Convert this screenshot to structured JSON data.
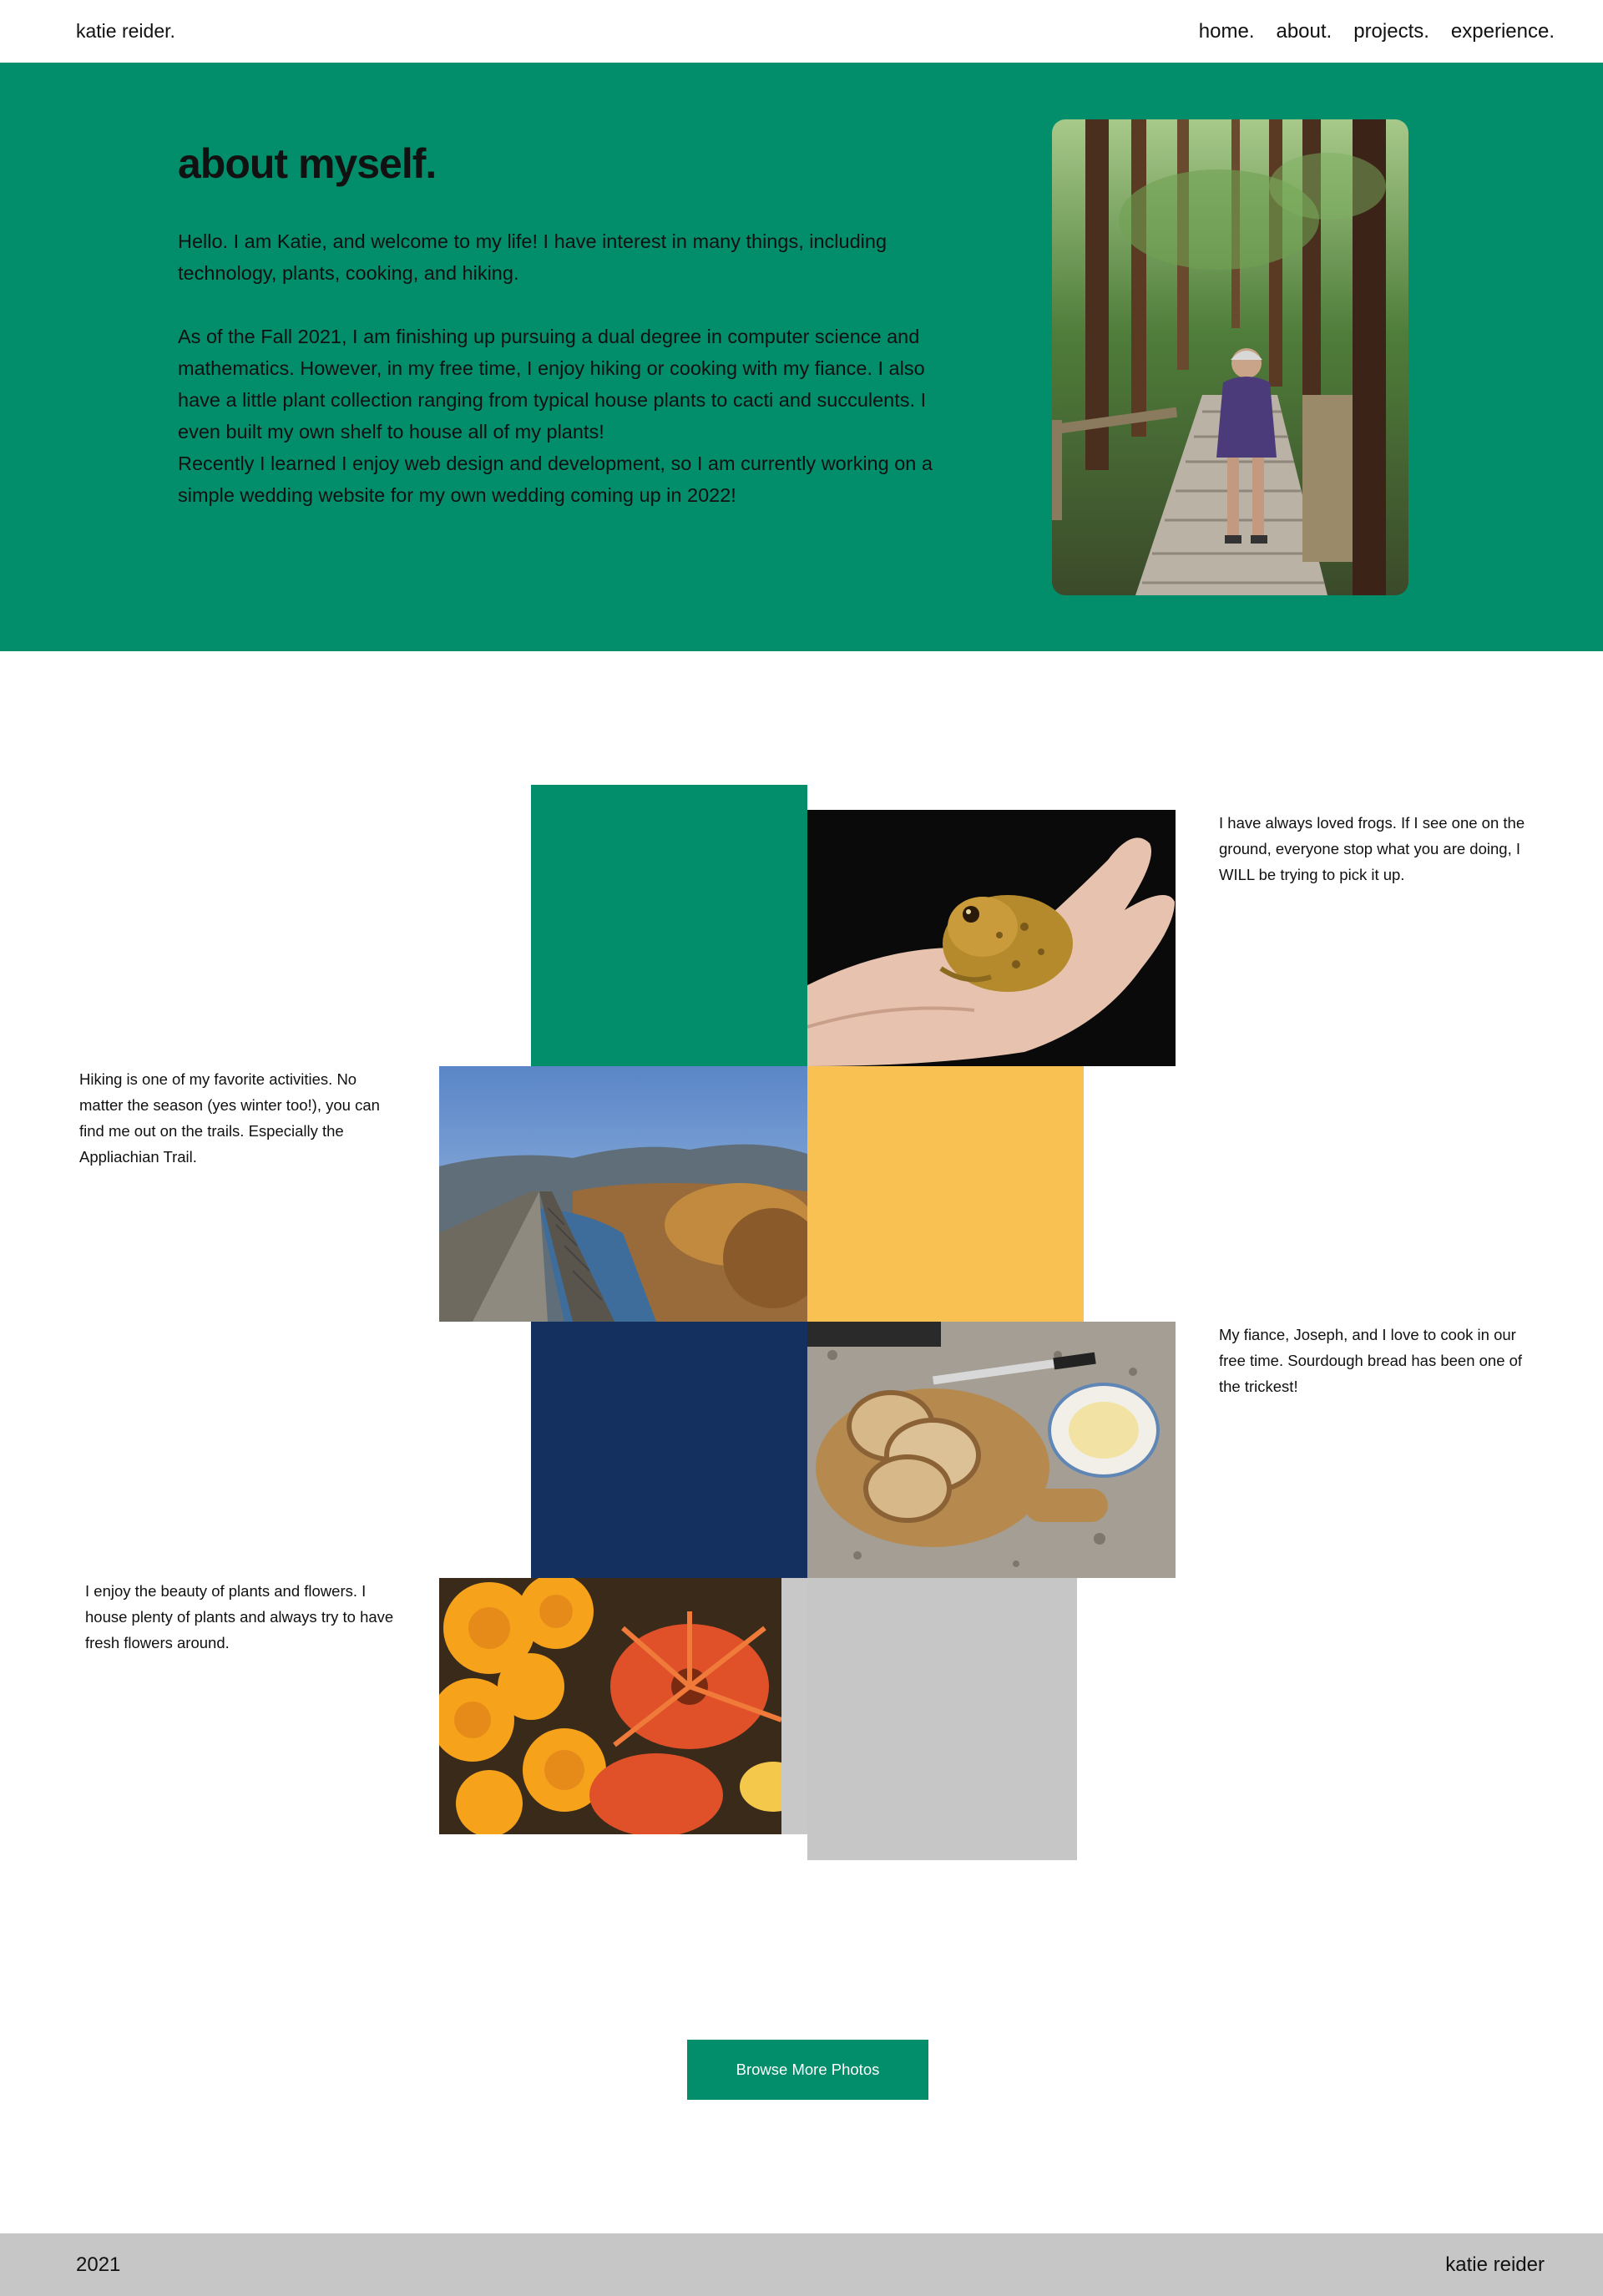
{
  "nav": {
    "brand": "katie reider.",
    "links": [
      "home.",
      "about.",
      "projects.",
      "experience."
    ]
  },
  "hero": {
    "title": "about myself.",
    "paragraphs": [
      "Hello. I am Katie, and welcome to my life! I have interest in many things, including technology, plants, cooking, and hiking.",
      "As of the Fall 2021, I am finishing up pursuing a dual degree in computer science and mathematics. However, in my free time, I enjoy hiking or cooking with my fiance. I also have a little plant collection ranging from typical house plants to cacti and succulents. I even built my own shelf to house all of my plants!",
      "Recently I learned I enjoy web design and development, so I am currently working on a simple wedding website for my own wedding coming up in 2022!"
    ],
    "photo_icon": "hiking-trail-photo"
  },
  "gallery": {
    "captions": {
      "frogs": "I have always loved frogs. If I see one on the ground, everyone stop what you are doing, I WILL be trying to pick it up.",
      "hiking": "Hiking is one of my favorite activities. No matter the season (yes winter too!), you can find me out on the trails. Especially the Appliachian Trail.",
      "cooking": "My fiance, Joseph, and I love to cook in our free time. Sourdough bread has been one of the trickest!",
      "plants": "I enjoy the beauty of plants and flowers. I house plenty of plants and always try to have fresh flowers around."
    },
    "colors": {
      "green": "#028d6b",
      "yellow": "#f8c152",
      "navy": "#13305f",
      "gray": "#c6c6c6"
    },
    "button_label": "Browse More Photos"
  },
  "footer": {
    "year": "2021",
    "name": "katie reider"
  }
}
